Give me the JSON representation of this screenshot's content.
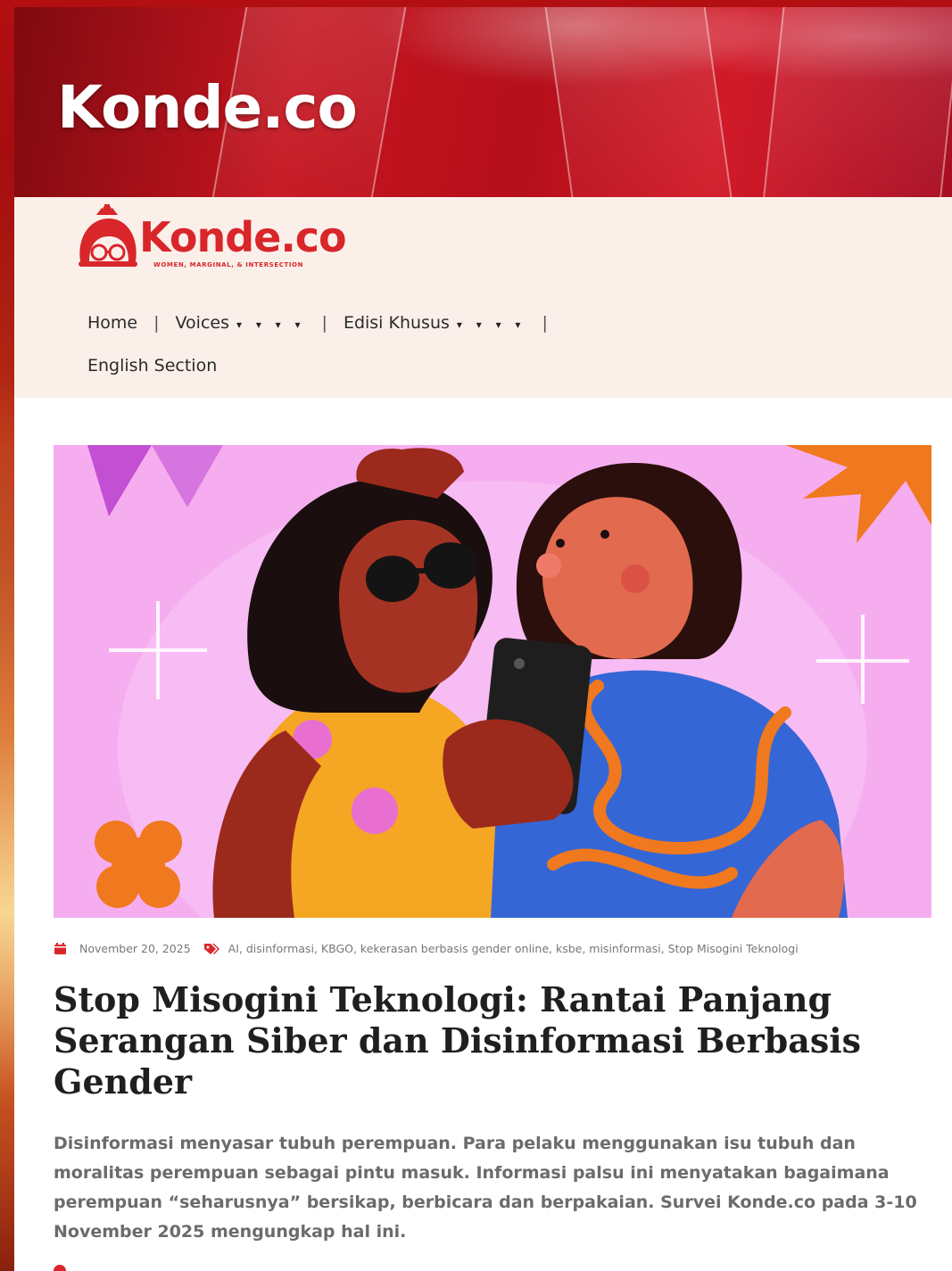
{
  "banner": {
    "title": "Konde.co"
  },
  "logo": {
    "name": "Konde.co",
    "tagline": "WOMEN, MARGINAL, & INTERSECTION"
  },
  "nav": {
    "items": [
      {
        "label": "Home"
      },
      {
        "label": "Voices",
        "dropdown": true
      },
      {
        "label": "Edisi Khusus",
        "dropdown": true
      },
      {
        "label": "English Section"
      }
    ],
    "separator": "|",
    "caret": "▾ ▾ ▾ ▾"
  },
  "article": {
    "date": "November 20, 2025",
    "tags": "AI, disinformasi, KBGO, kekerasan berbasis gender online, ksbe, misinformasi, Stop Misogini Teknologi",
    "title": "Stop Misogini Teknologi: Rantai Panjang Serangan Siber dan Disinformasi Berbasis Gender",
    "excerpt": "Disinformasi menyasar tubuh perempuan. Para pelaku menggunakan isu tubuh dan moralitas perempuan sebagai pintu masuk. Informasi palsu ini menyatakan bagaimana perempuan “seharusnya” bersikap, berbicara dan berpakaian. Survei Konde.co pada 3-10 November 2025 mengungkap hal ini."
  },
  "colors": {
    "brand": "#d8262a",
    "banner_red": "#c51520",
    "header_bg": "#fbefea",
    "hero_bg": "#f6adf0"
  },
  "icons": [
    "calendar-icon",
    "tag-icon",
    "logo-mascot-icon"
  ]
}
